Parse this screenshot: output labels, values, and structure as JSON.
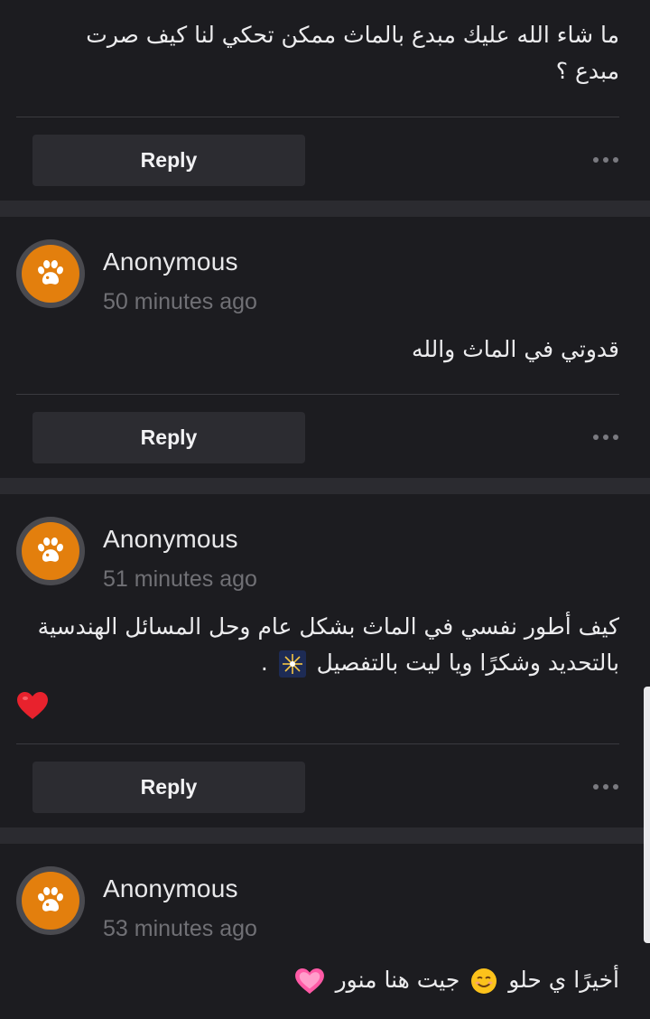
{
  "comments": [
    {
      "text_lines": [
        "ما شاء الله عليك مبدع بالماث ممكن تحكي لنا كيف صرت",
        "مبدع ؟"
      ],
      "reply_label": "Reply"
    },
    {
      "author": "Anonymous",
      "time": "50 minutes ago",
      "avatar_icon": "paw-icon",
      "text_lines": [
        "قدوتي في الماث والله"
      ],
      "reply_label": "Reply"
    },
    {
      "author": "Anonymous",
      "time": "51 minutes ago",
      "avatar_icon": "paw-icon",
      "text_lines": [
        "كيف أطور نفسي في الماث بشكل عام وحل المسائل الهندسية",
        "بالتحديد وشكرًا ويا ليت بالتفصيل",
        "."
      ],
      "emojis": [
        "fireworks-icon",
        "red-heart-icon"
      ],
      "reply_label": "Reply"
    },
    {
      "author": "Anonymous",
      "time": "53 minutes ago",
      "avatar_icon": "paw-icon",
      "text_parts": [
        "أخيرًا ي حلو",
        "جيت هنا منور"
      ],
      "emojis": [
        "smiling-face-icon",
        "pink-heart-icon"
      ]
    }
  ],
  "colors": {
    "background": "#1c1c20",
    "separator": "#2b2b30",
    "avatar_accent": "#e37f0d",
    "button": "#2c2c31",
    "meta_text": "#707075"
  }
}
